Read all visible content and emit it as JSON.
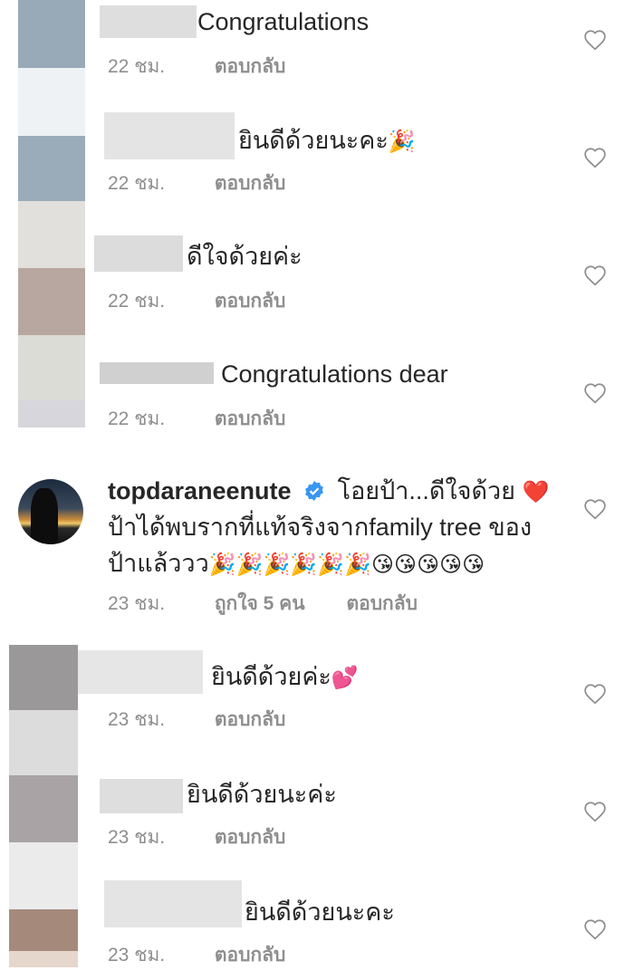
{
  "colors": {
    "secondary_text": "#8e8e8e",
    "primary_text": "#262626",
    "verified_blue": "#3897f0"
  },
  "comments": [
    {
      "text": "Congratulations",
      "time": "22 ชม.",
      "reply": "ตอบกลับ"
    },
    {
      "text": "ยินดีด้วยนะคะ",
      "emoji": "🎉",
      "time": "22 ชม.",
      "reply": "ตอบกลับ"
    },
    {
      "text": "ดีใจด้วยค่ะ",
      "time": "22 ชม.",
      "reply": "ตอบกลับ"
    },
    {
      "text": "Congratulations dear",
      "time": "22 ชม.",
      "reply": "ตอบกลับ"
    },
    {
      "username": "topdaraneenute",
      "line1": "โอยป้า...ดีใจด้วย",
      "heart_emoji": "❤️",
      "line2": "ป้าได้พบรากที่แท้จริงจากfamily tree ของ",
      "line3": "ป้าแล้ววว",
      "party_emojis": "🎉🎉🎉🎉🎉🎉",
      "kiss_emojis": "😘😘😘😘😘",
      "time": "23 ชม.",
      "likes": "ถูกใจ 5 คน",
      "reply": "ตอบกลับ"
    },
    {
      "text": "ยินดีด้วยค่ะ",
      "emoji": "💕",
      "time": "23 ชม.",
      "reply": "ตอบกลับ"
    },
    {
      "text": "ยินดีด้วยนะค่ะ",
      "time": "23 ชม.",
      "reply": "ตอบกลับ"
    },
    {
      "text": "ยินดีด้วยนะคะ",
      "time": "23 ชม.",
      "reply": "ตอบกลับ"
    }
  ]
}
